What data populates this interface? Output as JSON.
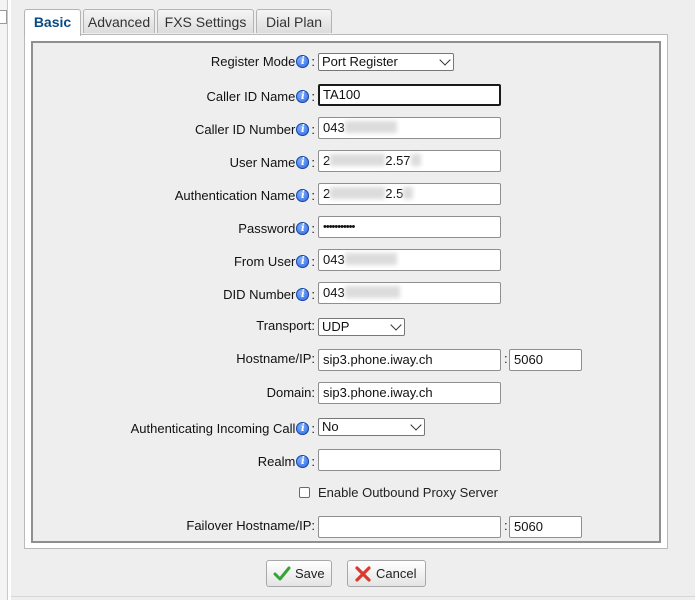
{
  "tabs": [
    {
      "label": "Basic",
      "active": true
    },
    {
      "label": "Advanced",
      "active": false
    },
    {
      "label": "FXS Settings",
      "active": false
    },
    {
      "label": "Dial Plan",
      "active": false
    }
  ],
  "form": {
    "register_mode": {
      "label": "Register Mode",
      "value": "Port Register"
    },
    "caller_id_name": {
      "label": "Caller ID Name",
      "value": "TA100"
    },
    "caller_id_number": {
      "label": "Caller ID Number",
      "value": "043"
    },
    "user_name": {
      "label": "User Name",
      "value_start": "2",
      "value_end": "2.57"
    },
    "authentication_name": {
      "label": "Authentication Name",
      "value_start": "2",
      "value_end": "2.5"
    },
    "password": {
      "label": "Password",
      "value": "•••••••••••"
    },
    "from_user": {
      "label": "From User",
      "value": "043"
    },
    "did_number": {
      "label": "DID Number",
      "value": "043"
    },
    "transport": {
      "label": "Transport:",
      "value": "UDP"
    },
    "hostname": {
      "label": "Hostname/IP:",
      "value": "sip3.phone.iway.ch",
      "port_separator": ":",
      "port": "5060"
    },
    "domain": {
      "label": "Domain:",
      "value": "sip3.phone.iway.ch"
    },
    "auth_incoming_call": {
      "label": "Authenticating Incoming Call",
      "value": "No"
    },
    "realm": {
      "label": "Realm",
      "value": ""
    },
    "outbound_proxy": {
      "label": "Enable Outbound Proxy Server",
      "checked": false
    },
    "failover": {
      "label": "Failover Hostname/IP:",
      "value": "",
      "port_separator": ":",
      "port": "5060"
    }
  },
  "info_glyph": "i",
  "colon": ":",
  "buttons": {
    "save": "Save",
    "cancel": "Cancel"
  },
  "icons": {
    "info": "info-icon",
    "save": "check-icon",
    "cancel": "x-icon",
    "dropdown": "chevron-down-icon"
  },
  "colors": {
    "active_tab_text": "#0a4a82",
    "info": "#2a5fd6",
    "check": "#34a534",
    "cancel": "#d83a2e"
  }
}
